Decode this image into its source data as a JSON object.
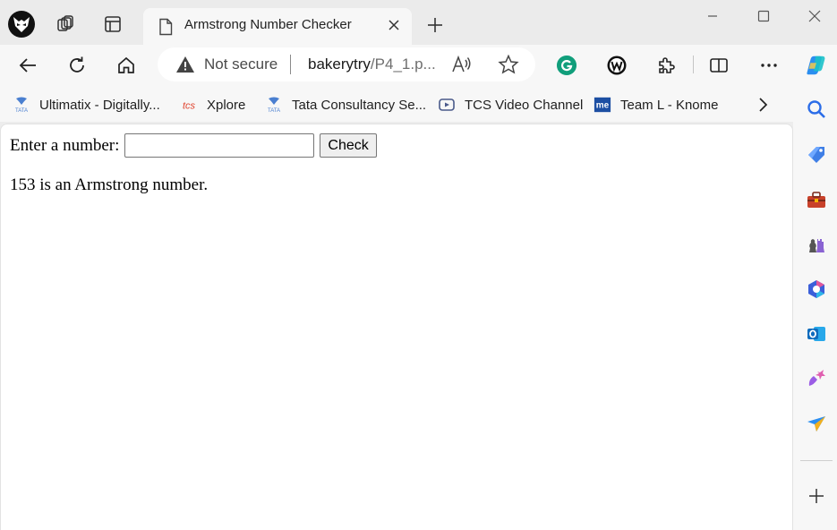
{
  "tab": {
    "title": "Armstrong Number Checker"
  },
  "address": {
    "security_label": "Not secure",
    "url_host": "bakerytry",
    "url_path": "/P4_1.p..."
  },
  "bookmarks": [
    {
      "label": "Ultimatix - Digitally...",
      "icon": "tata-icon"
    },
    {
      "label": "Xplore",
      "icon": "tcs-icon"
    },
    {
      "label": "Tata Consultancy Se...",
      "icon": "tata-icon"
    },
    {
      "label": "TCS Video Channel",
      "icon": "video-icon"
    },
    {
      "label": "Team L - Knome",
      "icon": "me-icon"
    }
  ],
  "page": {
    "label": "Enter a number:",
    "input_value": "",
    "check_label": "Check",
    "result_text": "153 is an Armstrong number."
  },
  "colors": {
    "accent_blue": "#2b6de8",
    "grammarly_green": "#15c39a",
    "outlook_blue": "#0f6cbd",
    "tools_red": "#c8412a"
  }
}
